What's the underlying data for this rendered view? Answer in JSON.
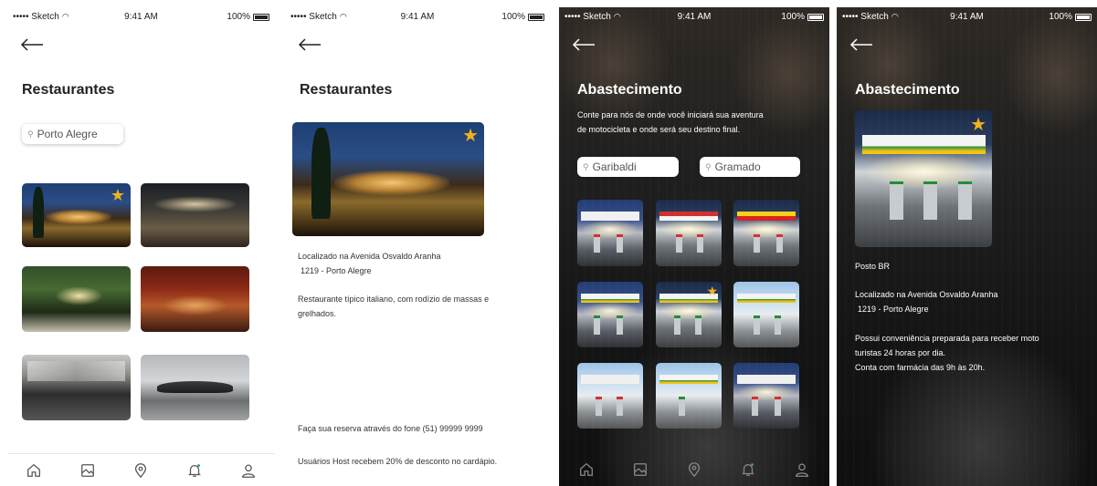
{
  "status_bar": {
    "carrier": "••••• Sketch",
    "time": "9:41 AM",
    "battery": "100%"
  },
  "screen1": {
    "title": "Restaurantes",
    "search_value": "Porto Alegre",
    "favorite_icon": "star-icon"
  },
  "screen2": {
    "title": "Restaurantes",
    "address_line1": "Localizado na Avenida Osvaldo Aranha",
    "address_line2": "1219 - Porto Alegre",
    "description_line1": "Restaurante típico italiano, com rodízio de massas e",
    "description_line2": "grelhados.",
    "reservation": "Faça sua reserva através do fone (51) 99999 9999",
    "discount": "Usuários Host recebem 20% de desconto no cardápio."
  },
  "screen3": {
    "title": "Abastecimento",
    "subtitle_line1": "Conte para nós de onde você iniciará sua aventura",
    "subtitle_line2": "de motocicleta e onde será seu destino final.",
    "origin_value": "Garibaldi",
    "destination_value": "Gramado"
  },
  "screen4": {
    "title": "Abastecimento",
    "station_name": "Posto BR",
    "address_line1": "Localizado na Avenida Osvaldo Aranha",
    "address_line2": "1219 - Porto Alegre",
    "info_line1": "Possui conveniência preparada para receber moto",
    "info_line2": "turistas 24 horas por dia.",
    "info_line3": "Conta com farmácia das 9h às 20h."
  },
  "nav_icons": [
    "home-icon",
    "gallery-icon",
    "location-pin-icon",
    "bell-icon",
    "user-icon"
  ],
  "colors": {
    "star": "#f2b01e",
    "dark_bg": "#141414",
    "light_bg": "#ffffff",
    "text_dark": "#222222"
  }
}
